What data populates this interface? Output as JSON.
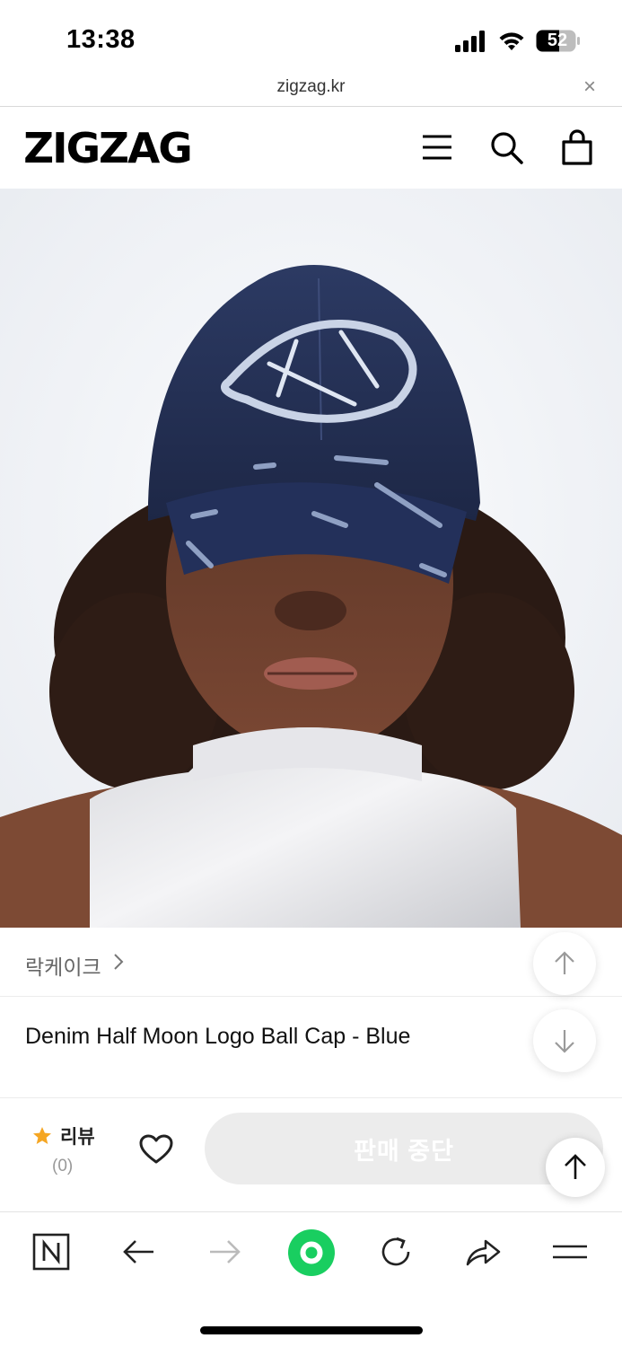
{
  "status_bar": {
    "time": "13:38",
    "battery": "52"
  },
  "browser": {
    "url": "zigzag.kr",
    "close": "×"
  },
  "header": {
    "logo": "ZIGZAG",
    "icons": [
      "menu-icon",
      "search-icon",
      "shopping-bag-icon"
    ]
  },
  "product": {
    "image_icon": "product-photo-denim-cap",
    "brand": "락케이크",
    "title": "Denim Half Moon Logo Ball Cap - Blue"
  },
  "purchase_bar": {
    "review_label": "리뷰",
    "review_count": "(0)",
    "button_label": "판매 중단",
    "accent_color": "#f5a623"
  },
  "toolbar": {
    "icons": [
      "naver-icon",
      "back-icon",
      "forward-icon",
      "home-icon",
      "reload-icon",
      "share-icon",
      "more-menu-icon"
    ],
    "home_color": "#19ce60"
  }
}
